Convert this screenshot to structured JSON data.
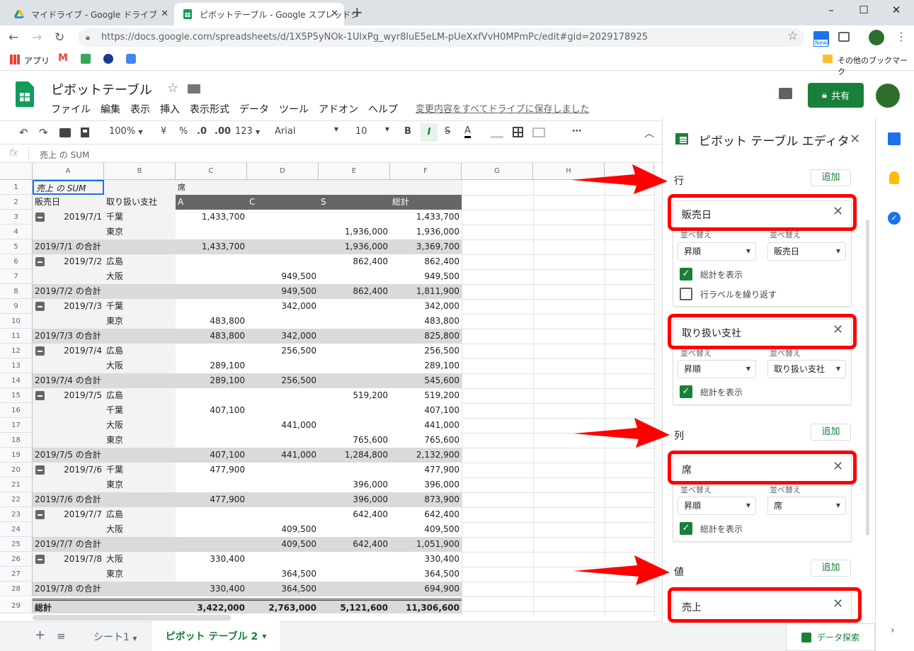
{
  "browser": {
    "tabs": [
      {
        "title": "マイドライブ - Google ドライブ"
      },
      {
        "title": "ピボットテーブル - Google スプレッドシ"
      }
    ],
    "url": "https://docs.google.com/spreadsheets/d/1X5P5yNOk-1UlxPg_wyr8luE5eLM-pUeXxfVvH0MPmPc/edit#gid=2029178925",
    "bookmarks": {
      "apps": "アプリ",
      "other": "その他のブックマーク"
    },
    "new_badge": "New"
  },
  "app": {
    "doc_title": "ピボットテーブル",
    "menu": [
      "ファイル",
      "編集",
      "表示",
      "挿入",
      "表示形式",
      "データ",
      "ツール",
      "アドオン",
      "ヘルプ"
    ],
    "saved_status": "変更内容をすべてドライブに保存しました",
    "share_label": "共有"
  },
  "toolbar": {
    "zoom": "100%",
    "currency": "¥",
    "percent": "%",
    "dec_less": ".0",
    "dec_more": ".00",
    "format_more": "123",
    "font": "Arial",
    "font_size": "10",
    "bold": "B",
    "italic": "I",
    "strike": "S",
    "text_color": "A",
    "more": "⋯"
  },
  "formula_bar": {
    "fx": "fx",
    "content": "売上 の SUM"
  },
  "grid": {
    "columns": [
      "A",
      "B",
      "C",
      "D",
      "E",
      "F",
      "G",
      "H"
    ],
    "r1": {
      "a": "売上 の SUM",
      "c": "席"
    },
    "r2": {
      "a": "販売日",
      "b": "取り扱い支社",
      "c": "A",
      "d": "C",
      "e": "S",
      "f": "総計"
    },
    "rows": [
      {
        "n": "3",
        "a": "2019/7/1",
        "b": "千葉",
        "c": "1,433,700",
        "d": "",
        "e": "",
        "f": "1,433,700",
        "type": "first"
      },
      {
        "n": "4",
        "a": "",
        "b": "東京",
        "c": "",
        "d": "",
        "e": "1,936,000",
        "f": "1,936,000",
        "type": "normal"
      },
      {
        "n": "5",
        "a": "2019/7/1 の合計",
        "b": "",
        "c": "1,433,700",
        "d": "",
        "e": "1,936,000",
        "f": "3,369,700",
        "type": "subtotal"
      },
      {
        "n": "6",
        "a": "2019/7/2",
        "b": "広島",
        "c": "",
        "d": "",
        "e": "862,400",
        "f": "862,400",
        "type": "first"
      },
      {
        "n": "7",
        "a": "",
        "b": "大阪",
        "c": "",
        "d": "949,500",
        "e": "",
        "f": "949,500",
        "type": "normal"
      },
      {
        "n": "8",
        "a": "2019/7/2 の合計",
        "b": "",
        "c": "",
        "d": "949,500",
        "e": "862,400",
        "f": "1,811,900",
        "type": "subtotal"
      },
      {
        "n": "9",
        "a": "2019/7/3",
        "b": "千葉",
        "c": "",
        "d": "342,000",
        "e": "",
        "f": "342,000",
        "type": "first"
      },
      {
        "n": "10",
        "a": "",
        "b": "東京",
        "c": "483,800",
        "d": "",
        "e": "",
        "f": "483,800",
        "type": "normal"
      },
      {
        "n": "11",
        "a": "2019/7/3 の合計",
        "b": "",
        "c": "483,800",
        "d": "342,000",
        "e": "",
        "f": "825,800",
        "type": "subtotal"
      },
      {
        "n": "12",
        "a": "2019/7/4",
        "b": "広島",
        "c": "",
        "d": "256,500",
        "e": "",
        "f": "256,500",
        "type": "first"
      },
      {
        "n": "13",
        "a": "",
        "b": "大阪",
        "c": "289,100",
        "d": "",
        "e": "",
        "f": "289,100",
        "type": "normal"
      },
      {
        "n": "14",
        "a": "2019/7/4 の合計",
        "b": "",
        "c": "289,100",
        "d": "256,500",
        "e": "",
        "f": "545,600",
        "type": "subtotal"
      },
      {
        "n": "15",
        "a": "2019/7/5",
        "b": "広島",
        "c": "",
        "d": "",
        "e": "519,200",
        "f": "519,200",
        "type": "first"
      },
      {
        "n": "16",
        "a": "",
        "b": "千葉",
        "c": "407,100",
        "d": "",
        "e": "",
        "f": "407,100",
        "type": "normal"
      },
      {
        "n": "17",
        "a": "",
        "b": "大阪",
        "c": "",
        "d": "441,000",
        "e": "",
        "f": "441,000",
        "type": "normal"
      },
      {
        "n": "18",
        "a": "",
        "b": "東京",
        "c": "",
        "d": "",
        "e": "765,600",
        "f": "765,600",
        "type": "normal"
      },
      {
        "n": "19",
        "a": "2019/7/5 の合計",
        "b": "",
        "c": "407,100",
        "d": "441,000",
        "e": "1,284,800",
        "f": "2,132,900",
        "type": "subtotal"
      },
      {
        "n": "20",
        "a": "2019/7/6",
        "b": "千葉",
        "c": "477,900",
        "d": "",
        "e": "",
        "f": "477,900",
        "type": "first"
      },
      {
        "n": "21",
        "a": "",
        "b": "東京",
        "c": "",
        "d": "",
        "e": "396,000",
        "f": "396,000",
        "type": "normal"
      },
      {
        "n": "22",
        "a": "2019/7/6 の合計",
        "b": "",
        "c": "477,900",
        "d": "",
        "e": "396,000",
        "f": "873,900",
        "type": "subtotal"
      },
      {
        "n": "23",
        "a": "2019/7/7",
        "b": "広島",
        "c": "",
        "d": "",
        "e": "642,400",
        "f": "642,400",
        "type": "first"
      },
      {
        "n": "24",
        "a": "",
        "b": "大阪",
        "c": "",
        "d": "409,500",
        "e": "",
        "f": "409,500",
        "type": "normal"
      },
      {
        "n": "25",
        "a": "2019/7/7 の合計",
        "b": "",
        "c": "",
        "d": "409,500",
        "e": "642,400",
        "f": "1,051,900",
        "type": "subtotal"
      },
      {
        "n": "26",
        "a": "2019/7/8",
        "b": "大阪",
        "c": "330,400",
        "d": "",
        "e": "",
        "f": "330,400",
        "type": "first"
      },
      {
        "n": "27",
        "a": "",
        "b": "東京",
        "c": "",
        "d": "364,500",
        "e": "",
        "f": "364,500",
        "type": "normal"
      },
      {
        "n": "28",
        "a": "2019/7/8 の合計",
        "b": "",
        "c": "330,400",
        "d": "364,500",
        "e": "",
        "f": "694,900",
        "type": "subtotal"
      },
      {
        "n": "29",
        "a": "総計",
        "b": "",
        "c": "3,422,000",
        "d": "2,763,000",
        "e": "5,121,600",
        "f": "11,306,600",
        "type": "grand"
      }
    ],
    "row_header_top": [
      "1",
      "2"
    ]
  },
  "sheets": {
    "sheet1": "シート1",
    "active": "ピボット テーブル 2",
    "explore": "データ探索"
  },
  "pivot_editor": {
    "title": "ピボット テーブル エディタ",
    "add_label": "追加",
    "sort_label": "並べ替え",
    "rows_label": "行",
    "columns_label": "列",
    "values_label": "値",
    "cards": [
      {
        "field": "販売日",
        "order": "昇順",
        "sort_by": "販売日",
        "show_totals": "総計を表示",
        "repeat_labels": "行ラベルを繰り返す"
      },
      {
        "field": "取り扱い支社",
        "order": "昇順",
        "sort_by": "取り扱い支社",
        "show_totals": "総計を表示"
      },
      {
        "field": "席",
        "order": "昇順",
        "sort_by": "席",
        "show_totals": "総計を表示"
      },
      {
        "field": "売上"
      }
    ]
  },
  "colors": {
    "accent": "#188038",
    "annotation_red": "#ff0000",
    "pivot_header": "#666666",
    "subtotal_row": "#dadada"
  }
}
